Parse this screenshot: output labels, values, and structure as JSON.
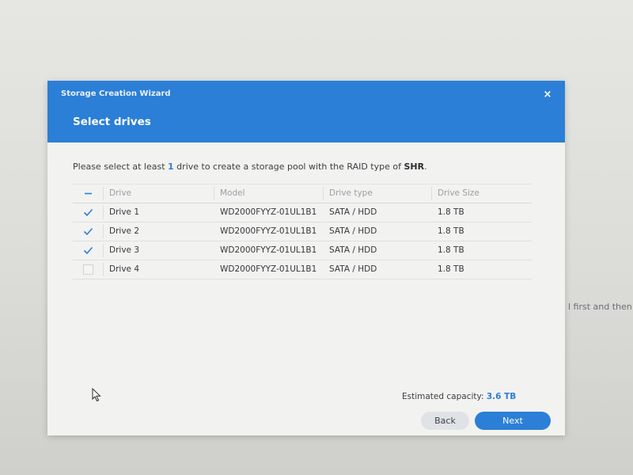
{
  "background": {
    "partial_text": "l first and then c"
  },
  "dialog": {
    "wizard_title": "Storage Creation Wizard",
    "close_symbol": "×",
    "step_title": "Select drives",
    "instruction": {
      "prefix": "Please select at least ",
      "count": "1",
      "middle": " drive to create a storage pool with the RAID type of ",
      "raid": "SHR",
      "suffix": "."
    },
    "table": {
      "headers": {
        "drive": "Drive",
        "model": "Model",
        "type": "Drive type",
        "size": "Drive Size"
      },
      "header_checkbox": "partial",
      "rows": [
        {
          "checked": true,
          "drive": "Drive 1",
          "model": "WD2000FYYZ-01UL1B1",
          "type": "SATA / HDD",
          "size": "1.8 TB"
        },
        {
          "checked": true,
          "drive": "Drive 2",
          "model": "WD2000FYYZ-01UL1B1",
          "type": "SATA / HDD",
          "size": "1.8 TB"
        },
        {
          "checked": true,
          "drive": "Drive 3",
          "model": "WD2000FYYZ-01UL1B1",
          "type": "SATA / HDD",
          "size": "1.8 TB"
        },
        {
          "checked": false,
          "drive": "Drive 4",
          "model": "WD2000FYYZ-01UL1B1",
          "type": "SATA / HDD",
          "size": "1.8 TB"
        }
      ]
    },
    "capacity": {
      "label": "Estimated capacity: ",
      "value": "3.6 TB"
    },
    "buttons": {
      "back": "Back",
      "next": "Next"
    }
  },
  "colors": {
    "accent": "#2b7fd6",
    "header_bg": "#2b7fd6",
    "dialog_bg": "#f2f2f0",
    "back_button_bg": "#dfe3e6"
  },
  "icons": {
    "close": "close-icon",
    "check": "check-icon",
    "partial": "minus-icon",
    "cursor": "mouse-cursor-icon"
  }
}
